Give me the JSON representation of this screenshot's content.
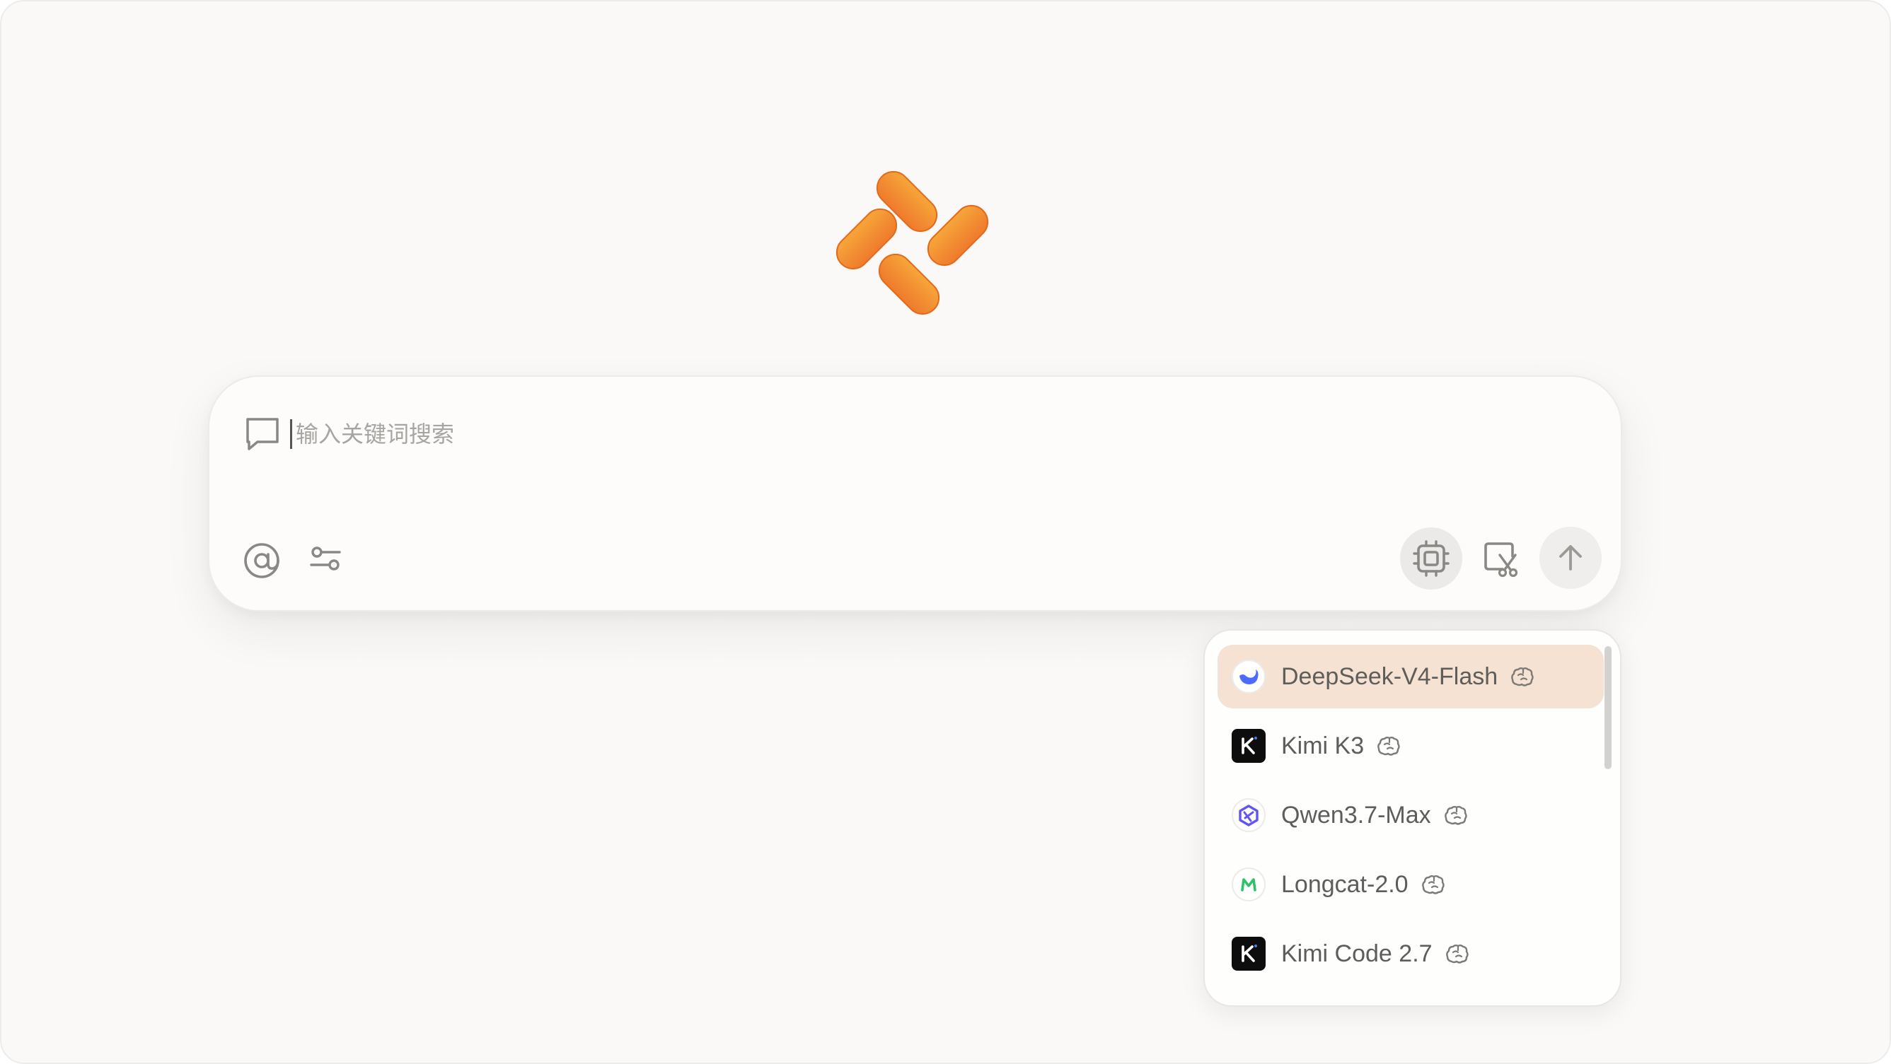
{
  "search": {
    "placeholder": "输入关键词搜索"
  },
  "toolbar": {
    "left_icons": [
      "chat-bubble-icon",
      "at-sign-icon",
      "sliders-icon"
    ],
    "right_icons": [
      "chip-icon",
      "screenshot-cut-icon",
      "arrow-up-icon"
    ]
  },
  "model_menu": {
    "selected_index": 0,
    "items": [
      {
        "label": "DeepSeek-V4-Flash",
        "icon": "deepseek-logo-icon",
        "badge": "brain-icon"
      },
      {
        "label": "Kimi K3",
        "icon": "kimi-logo-icon",
        "badge": "brain-icon"
      },
      {
        "label": "Qwen3.7-Max",
        "icon": "qwen-logo-icon",
        "badge": "brain-icon"
      },
      {
        "label": "Longcat-2.0",
        "icon": "longcat-logo-icon",
        "badge": "brain-icon"
      },
      {
        "label": "Kimi Code 2.7",
        "icon": "kimi-logo-icon",
        "badge": "brain-icon"
      }
    ]
  },
  "colors": {
    "background": "#fbf9f7",
    "accent_orange": "#f08a35",
    "selected_item": "#f6e2d3"
  }
}
